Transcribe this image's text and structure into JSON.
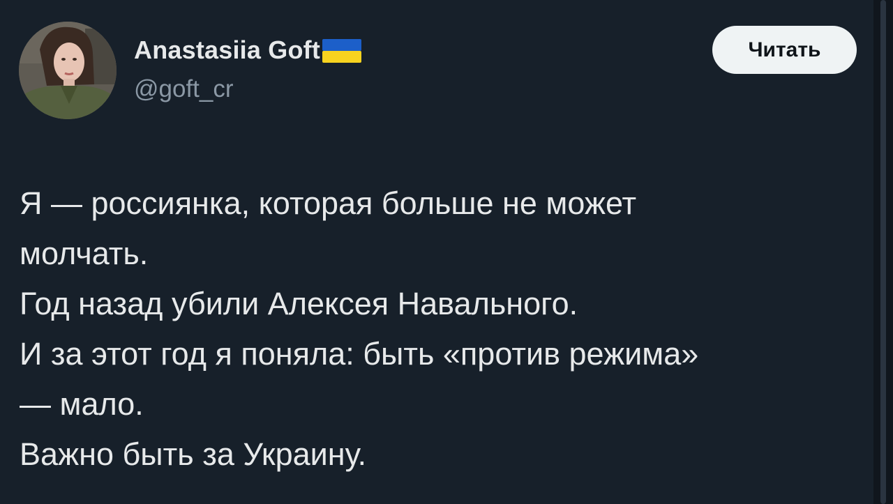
{
  "author": {
    "display_name": "Anastasiia Goft",
    "handle": "@goft_cr",
    "flag_icon": "ukraine-flag-icon",
    "avatar_icon": "profile-photo-icon"
  },
  "follow_button": {
    "label": "Читать"
  },
  "tweet": {
    "lines": [
      "Я — россиянка, которая больше не может",
      "молчать.",
      "Год назад убили Алексея Навального.",
      "И за этот год я поняла: быть «против режима»",
      "— мало.",
      "Важно быть за Украину."
    ]
  },
  "colors": {
    "background": "#17202a",
    "text": "#e7e9ea",
    "secondary_text": "#8b98a5",
    "button_bg": "#eff3f4",
    "flag_blue": "#1c5fc9",
    "flag_yellow": "#f7d31f"
  }
}
